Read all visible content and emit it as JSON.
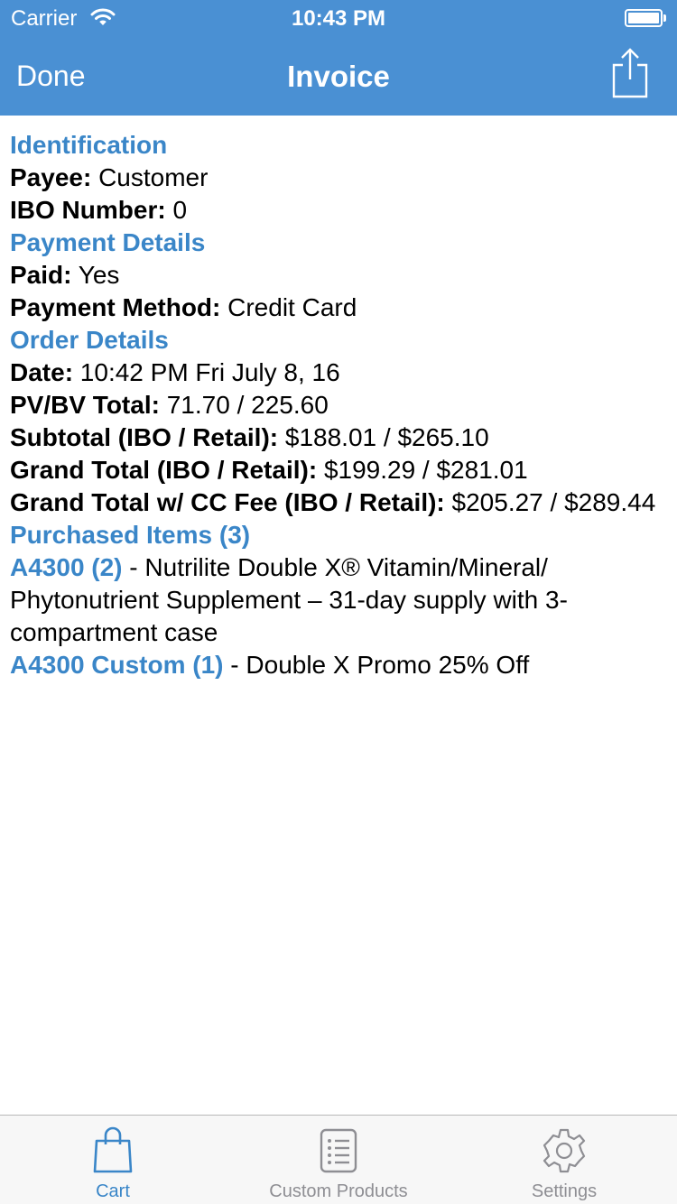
{
  "status_bar": {
    "carrier": "Carrier",
    "time": "10:43 PM",
    "icons": [
      "wifi-icon",
      "battery-icon"
    ]
  },
  "nav": {
    "left_button": "Done",
    "title": "Invoice",
    "right_icon": "share-icon"
  },
  "invoice": {
    "identification": {
      "header": "Identification",
      "payee_label": "Payee:",
      "payee_value": "Customer",
      "ibo_label": "IBO Number:",
      "ibo_value": "0"
    },
    "payment": {
      "header": "Payment Details",
      "paid_label": "Paid:",
      "paid_value": "Yes",
      "method_label": "Payment Method:",
      "method_value": "Credit Card"
    },
    "order": {
      "header": "Order Details",
      "date_label": "Date:",
      "date_value": "10:42 PM Fri July 8, 16",
      "pvbv_label": "PV/BV Total:",
      "pvbv_value": "71.70 / 225.60",
      "subtotal_label": "Subtotal (IBO / Retail):",
      "subtotal_value": "$188.01 / $265.10",
      "grand_label": "Grand Total (IBO / Retail):",
      "grand_value": "$199.29 / $281.01",
      "grand_cc_label": "Grand Total w/ CC Fee (IBO / Retail):",
      "grand_cc_value": "$205.27 / $289.44"
    },
    "items": {
      "header": "Purchased Items (3)",
      "list": [
        {
          "code": "A4300  (2)",
          "description": " - Nutrilite Double X® Vitamin/Mineral/ Phytonutrient Supplement – 31-day supply with 3-compartment case"
        },
        {
          "code": "A4300 Custom (1)",
          "description": " - Double X Promo 25% Off"
        }
      ]
    }
  },
  "tabbar": {
    "tabs": [
      {
        "label": "Cart",
        "icon": "bag-icon",
        "active": true
      },
      {
        "label": "Custom Products",
        "icon": "list-icon",
        "active": false
      },
      {
        "label": "Settings",
        "icon": "gear-icon",
        "active": false
      }
    ]
  },
  "colors": {
    "header_bg": "#4a90d3",
    "accent": "#3a86c8",
    "tab_inactive": "#8e8e93"
  }
}
